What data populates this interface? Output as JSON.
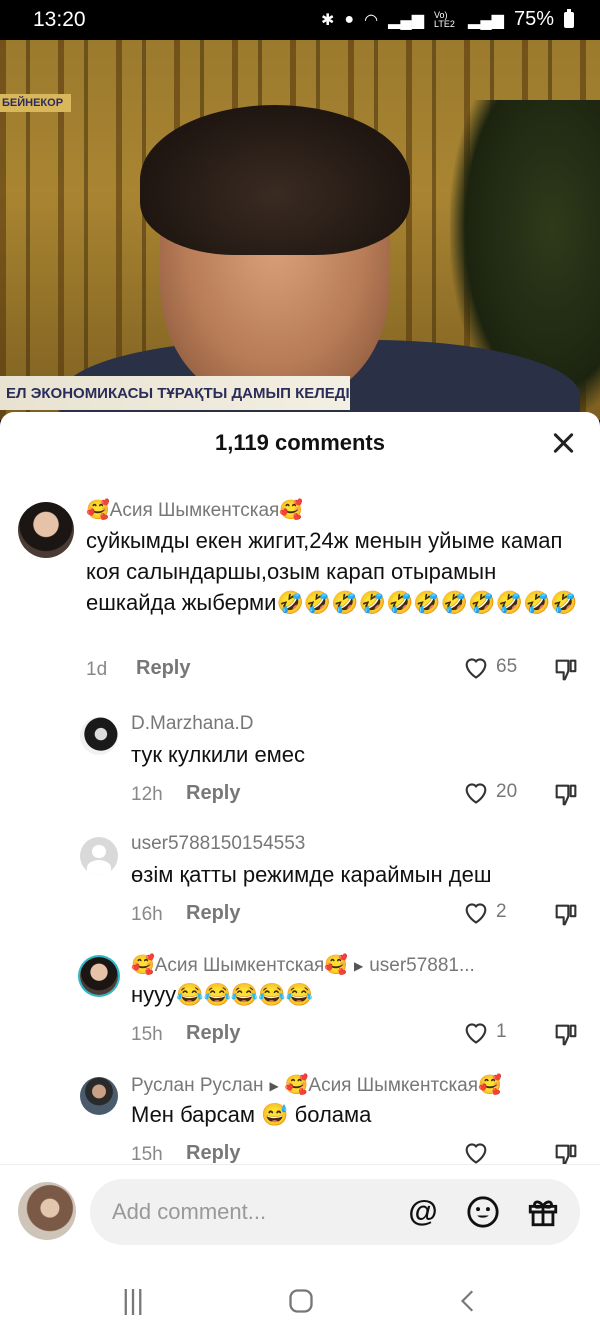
{
  "status": {
    "time": "13:20",
    "battery": "75%",
    "icons": [
      "bluetooth-icon",
      "location-icon",
      "wifi-icon",
      "signal-icon",
      "volte-icon",
      "signal-icon",
      "battery-icon"
    ],
    "volte": "Vo) LTE2"
  },
  "video": {
    "channel_tag": "БЕЙНЕКОР",
    "lower_third": "ЕЛ ЭКОНОМИКАСЫ ТҰРАҚТЫ ДАМЫП КЕЛЕДІ"
  },
  "sheet": {
    "title": "1,119 comments",
    "close_icon": "close-icon"
  },
  "comments": [
    {
      "name": "🥰Асия Шымкентская🥰",
      "text": "суйкымды екен жигит,24ж менын уйыме камап коя салындаршы,озым карап отырамын ешкайда жыберми🤣🤣🤣🤣🤣🤣🤣🤣🤣🤣🤣",
      "time": "1d",
      "reply_label": "Reply",
      "likes": "65"
    },
    {
      "name": "D.Marzhana.D",
      "text": "тук кулкили емес",
      "time": "12h",
      "reply_label": "Reply",
      "likes": "20"
    },
    {
      "name": "user5788150154553",
      "text": "өзім қатты режимде караймын деш",
      "time": "16h",
      "reply_label": "Reply",
      "likes": "2"
    },
    {
      "name": "🥰Асия Шымкентская🥰",
      "reply_to": "user57881...",
      "text": "нууу😂😂😂😂😂",
      "time": "15h",
      "reply_label": "Reply",
      "likes": "1"
    },
    {
      "name": "Руслан Руслан",
      "reply_to": "🥰Асия Шымкентская🥰",
      "text": "Мен барсам 😅 болама",
      "time": "15h",
      "reply_label": "Reply",
      "likes": ""
    }
  ],
  "composer": {
    "placeholder": "Add comment...",
    "icons": [
      "mention-icon",
      "emoji-icon",
      "gift-icon"
    ],
    "mention_glyph": "@"
  },
  "nav": {
    "icons": [
      "recent-apps-icon",
      "home-icon",
      "back-icon"
    ]
  }
}
